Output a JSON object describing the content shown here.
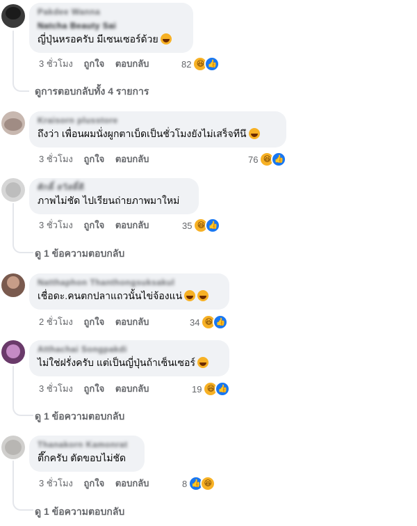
{
  "comments": [
    {
      "name": "Pakdee Wanna",
      "handle": "Natcha Beauty Sai",
      "text": "ญี่ปุ่นหรอครับ มีเซนเซอร์ด้วย",
      "time": "3 ชั่วโมง",
      "like": "ถูกใจ",
      "reply": "ตอบกลับ",
      "reaction_count": "82",
      "reactions": [
        "haha-icon",
        "like-icon"
      ],
      "replies_link": "ดูการตอบกลับทั้ง 4 รายการ"
    },
    {
      "name": "Kraisorn plusstore",
      "text": "ถึงว่า เพื่อนผมนั่งผูกตาเบ็ดเป็นชั่วโมงยังไม่เสร็จทีนึ",
      "time": "3 ชั่วโมง",
      "like": "ถูกใจ",
      "reply": "ตอบกลับ",
      "reaction_count": "76",
      "reactions": [
        "haha-icon",
        "like-icon"
      ]
    },
    {
      "name": "ศักดิ์ สวัสดิ์ดี",
      "text": "ภาพไม่ชัด ไปเรียนถ่ายภาพมาใหม่",
      "time": "3 ชั่วโมง",
      "like": "ถูกใจ",
      "reply": "ตอบกลับ",
      "reaction_count": "35",
      "reactions": [
        "haha-icon",
        "like-icon"
      ],
      "replies_link": "ดู 1 ข้อความตอบกลับ"
    },
    {
      "name": "Natthaphon Thanthongsuksakul",
      "text": "เชื่อดะ.คนตกปลาแถวนั้นไข่จ้องแน่",
      "time": "2 ชั่วโมง",
      "like": "ถูกใจ",
      "reply": "ตอบกลับ",
      "reaction_count": "34",
      "reactions": [
        "haha-icon",
        "like-icon"
      ]
    },
    {
      "name": "Atthachai Songpakdi",
      "text": "ไม่ใช่ฝรั่งครับ แต่เป็นญี่ปุ่นถ้าเซ็นเซอร์",
      "time": "3 ชั่วโมง",
      "like": "ถูกใจ",
      "reply": "ตอบกลับ",
      "reaction_count": "19",
      "reactions": [
        "haha-icon",
        "like-icon"
      ],
      "replies_link": "ดู 1 ข้อความตอบกลับ"
    },
    {
      "name": "Thanakorn Kamonrat",
      "text": "ตึ๊กครับ ตัดขอบไม่ชัด",
      "time": "3 ชั่วโมง",
      "like": "ถูกใจ",
      "reply": "ตอบกลับ",
      "reaction_count": "8",
      "reactions": [
        "like-icon",
        "haha-icon"
      ],
      "replies_link": "ดู 1 ข้อความตอบกลับ"
    }
  ],
  "colors": {
    "bubble": "#f0f2f5",
    "meta_text": "#65676b",
    "like_blue": "#1877f2",
    "haha_yellow": "#f7b125"
  }
}
